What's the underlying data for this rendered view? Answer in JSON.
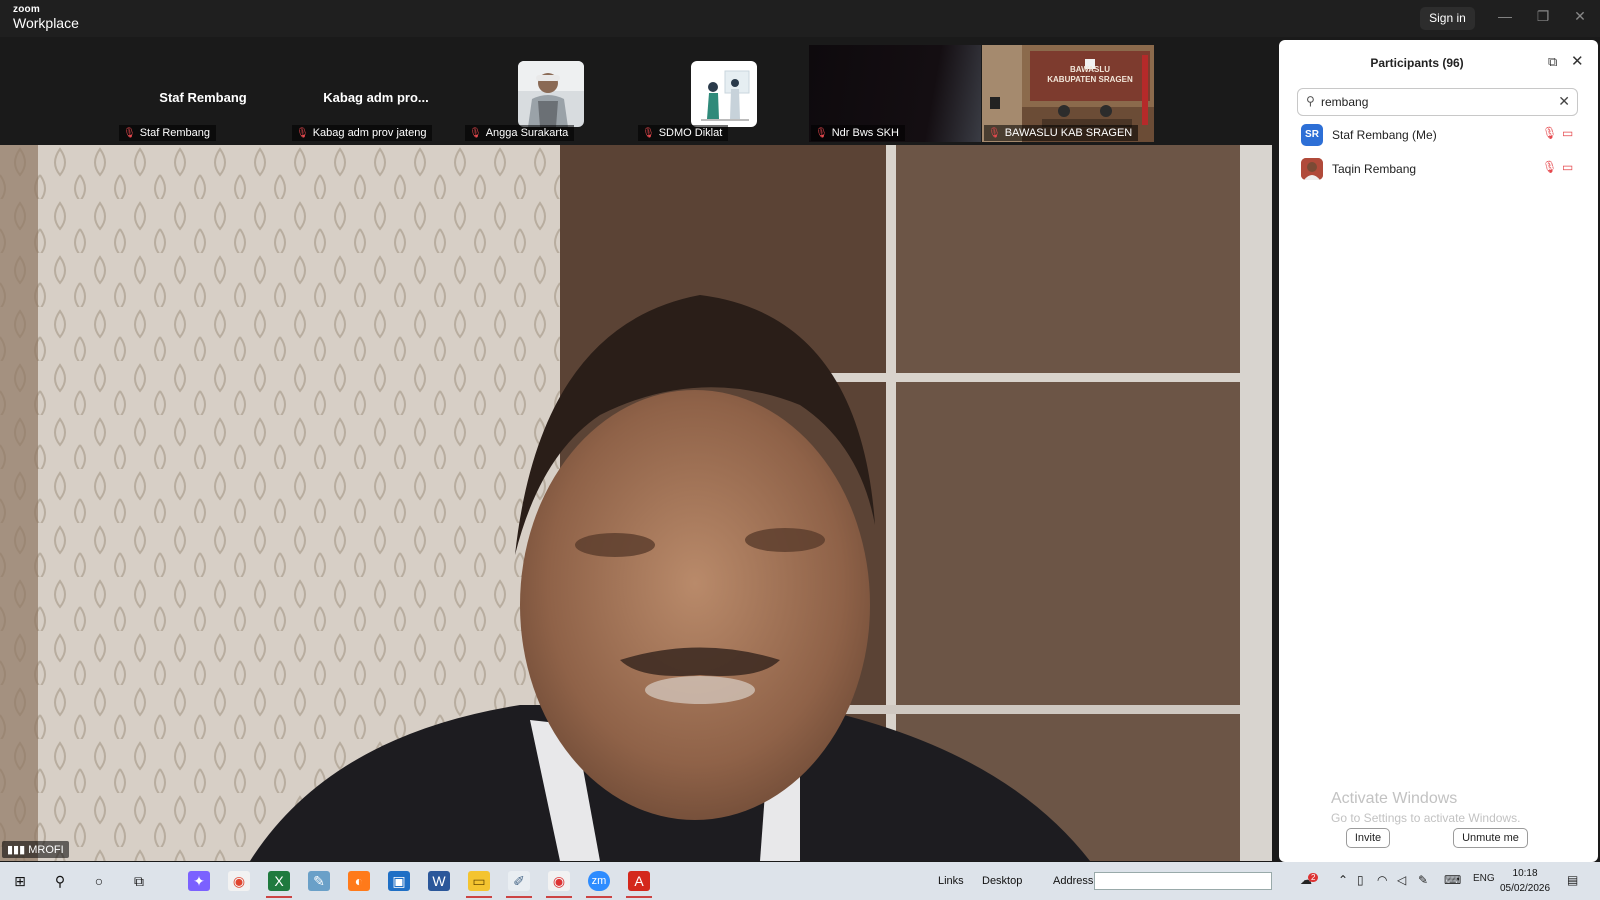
{
  "app": {
    "brand_small": "zoom",
    "brand_large": "Workplace",
    "signin_label": "Sign in"
  },
  "window_controls": {
    "minimize": "—",
    "restore": "❐",
    "close": "✕"
  },
  "gallery": [
    {
      "display_name": "Staf Rembang",
      "label": "Staf Rembang",
      "kind": "name"
    },
    {
      "display_name": "Kabag adm pro...",
      "label": "Kabag adm prov jateng",
      "kind": "name"
    },
    {
      "display_name": "",
      "label": "Angga Surakarta",
      "kind": "avatar"
    },
    {
      "display_name": "",
      "label": "SDMO Diklat",
      "kind": "avatar"
    },
    {
      "display_name": "",
      "label": "Ndr Bws SKH",
      "kind": "video-dark"
    },
    {
      "display_name": "",
      "label": "BAWASLU KAB SRAGEN",
      "kind": "video-room"
    }
  ],
  "room_banner": {
    "line1": "BAWASLU",
    "line2": "KABUPATEN SRAGEN"
  },
  "main_video": {
    "speaker_label": "MROFI"
  },
  "participants": {
    "title": "Participants (96)",
    "search_value": "rembang",
    "items": [
      {
        "initials": "SR",
        "name": "Staf Rembang (Me)",
        "avatar_color": "#2d6fd6"
      },
      {
        "initials": "",
        "name": "Taqin Rembang",
        "avatar_color": "#b04a3a"
      }
    ],
    "invite_label": "Invite",
    "unmute_label": "Unmute me"
  },
  "watermark": {
    "line1": "Activate Windows",
    "line2": "Go to Settings to activate Windows."
  },
  "taskbar": {
    "links_label": "Links",
    "desktop_label": "Desktop",
    "address_label": "Address",
    "language": "ENG",
    "notification_count": "2",
    "time": "10:18",
    "date": "05/02/2026"
  }
}
